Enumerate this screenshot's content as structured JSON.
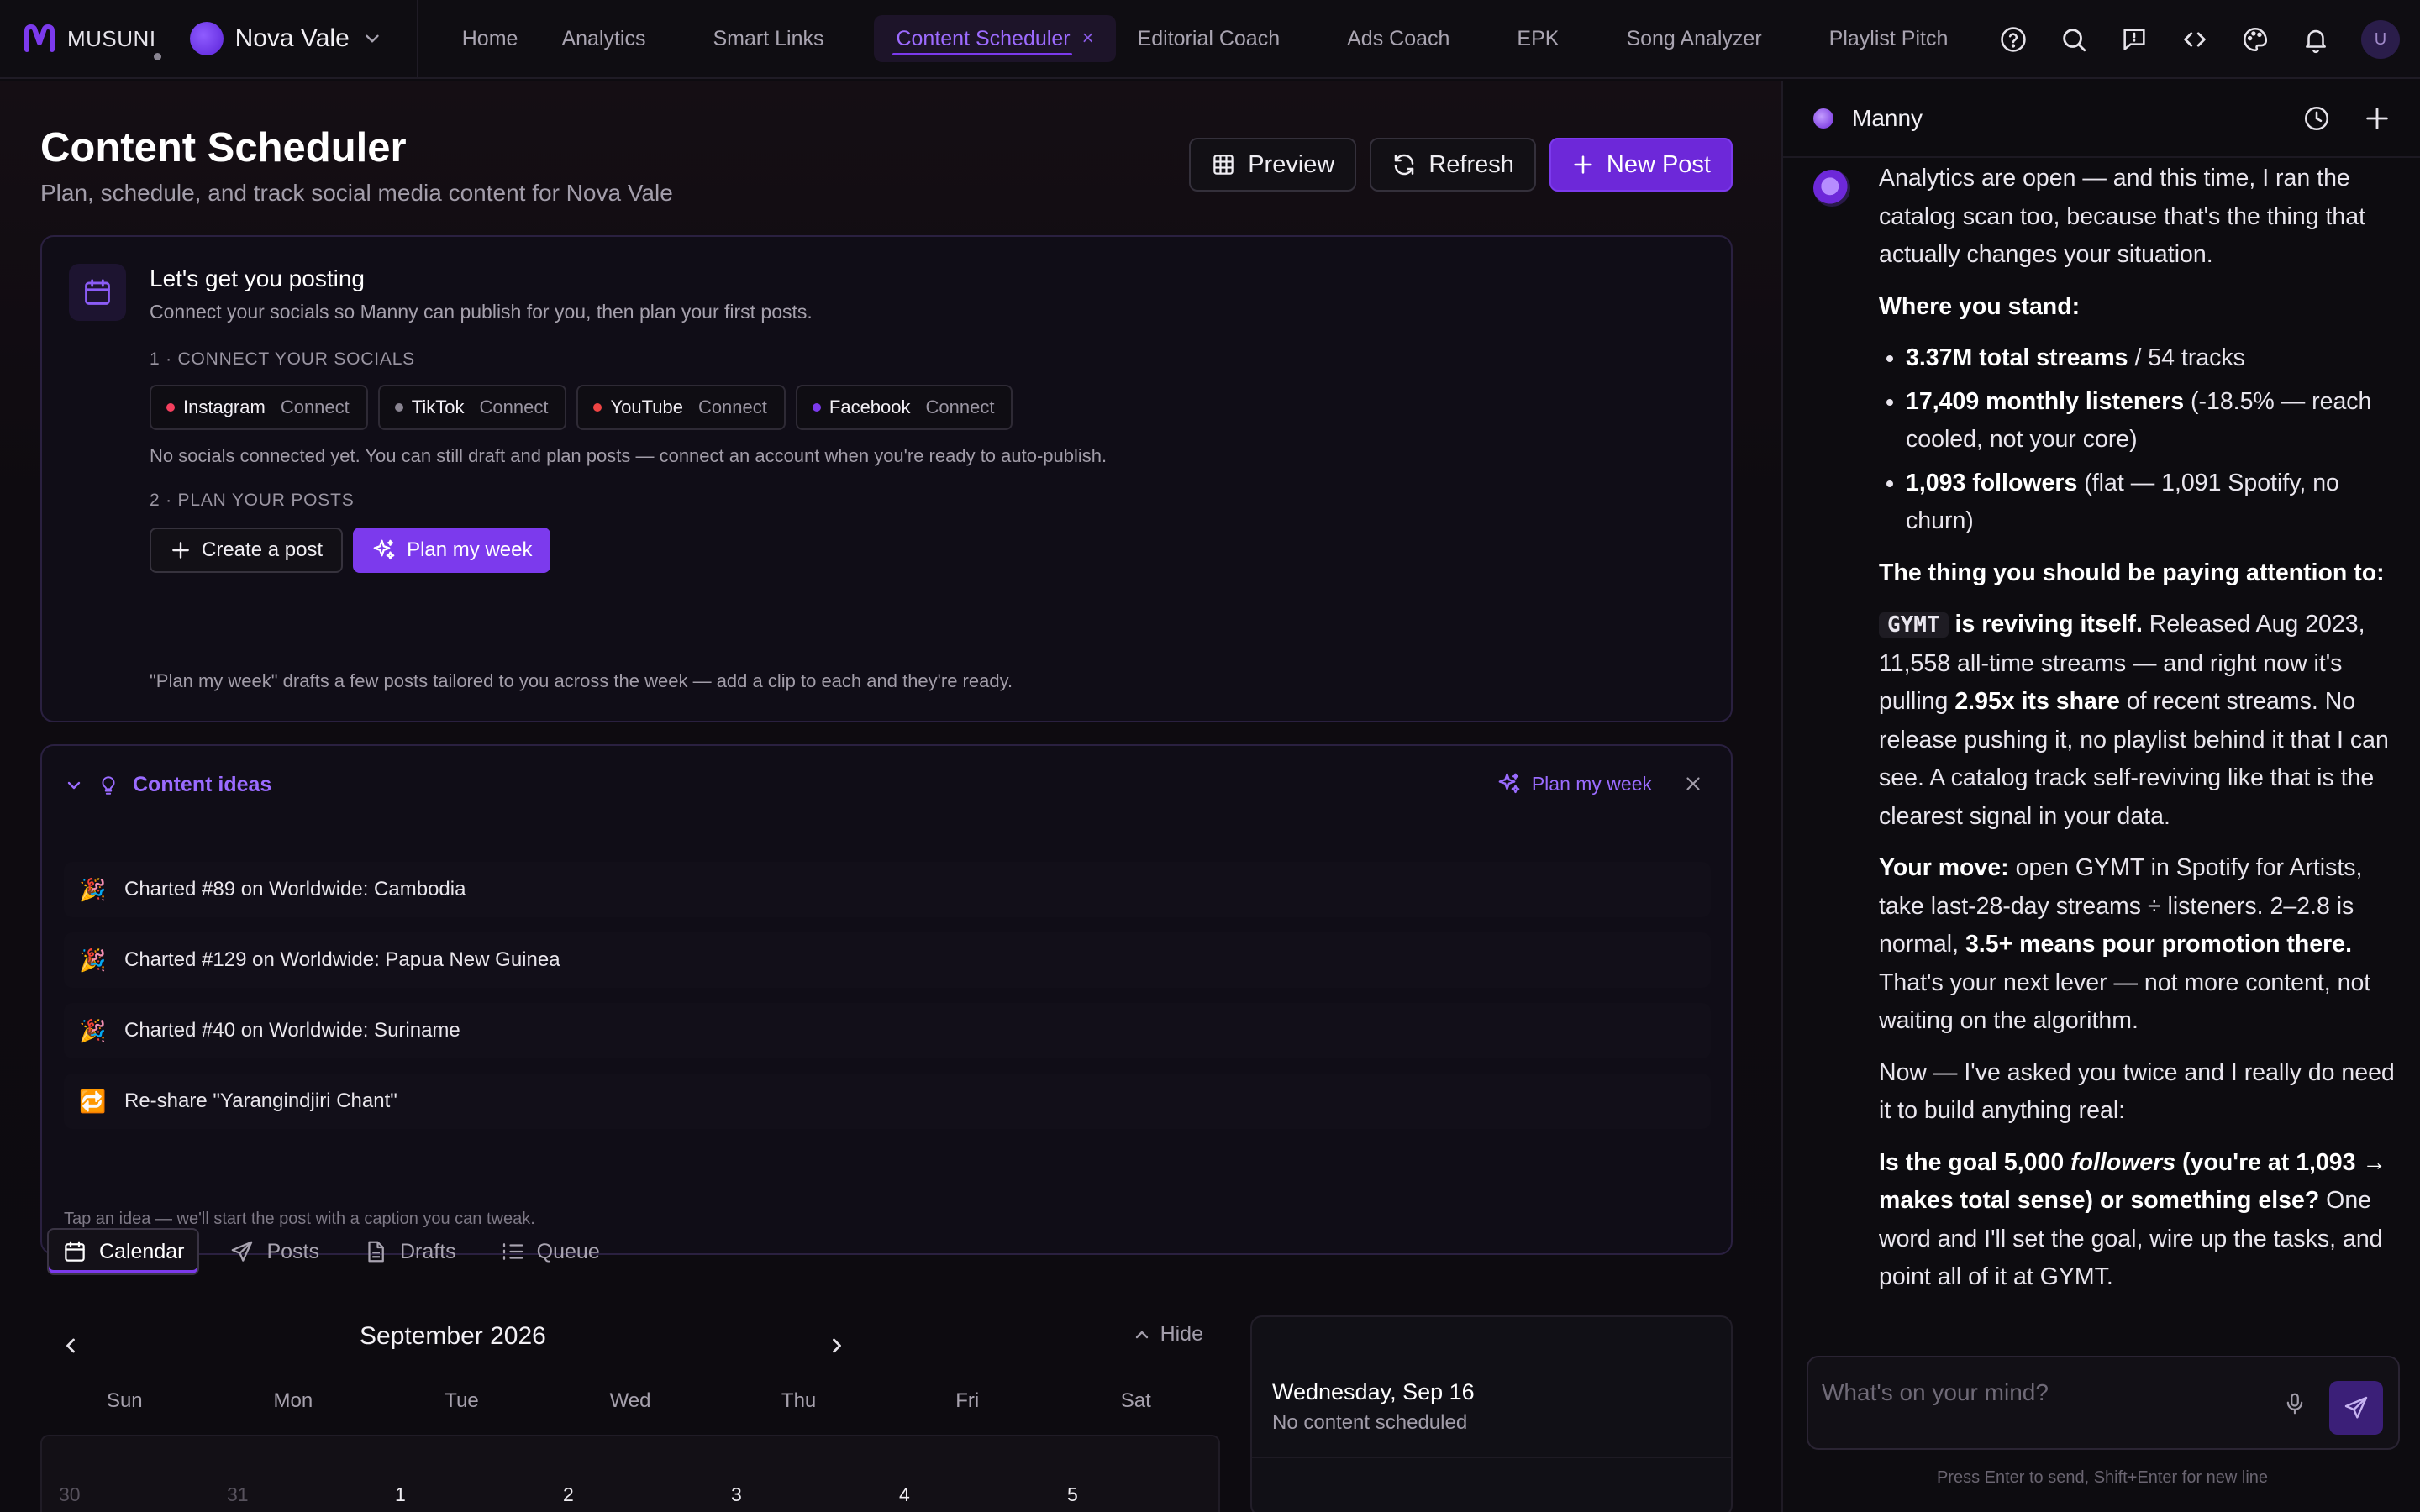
{
  "brand": {
    "name": "MUSUNI"
  },
  "artist": {
    "name": "Nova Vale"
  },
  "nav": {
    "items": [
      "Home",
      "Analytics",
      "Smart Links",
      "Content Scheduler",
      "Editorial Coach",
      "Ads Coach",
      "EPK",
      "Song Analyzer",
      "Playlist Pitch"
    ],
    "active_index": 3,
    "close_glyph": "×"
  },
  "top_icons": [
    "help-icon",
    "search-icon",
    "feedback-icon",
    "code-icon",
    "palette-icon",
    "bell-icon"
  ],
  "user": {
    "initial": "U"
  },
  "page": {
    "title": "Content Scheduler",
    "subtitle": "Plan, schedule, and track social media content for Nova Vale",
    "buttons": {
      "preview": "Preview",
      "refresh": "Refresh",
      "new_post": "New Post"
    }
  },
  "setup": {
    "title": "Let's get you posting",
    "subtitle": "Connect your socials so Manny can publish for you, then plan your first posts.",
    "step1": "1 · CONNECT YOUR SOCIALS",
    "socials": [
      {
        "name": "Instagram",
        "action": "Connect",
        "color": "#f43f5e"
      },
      {
        "name": "TikTok",
        "action": "Connect",
        "color": "#8a8592"
      },
      {
        "name": "YouTube",
        "action": "Connect",
        "color": "#ef4444"
      },
      {
        "name": "Facebook",
        "action": "Connect",
        "color": "#7c3aed"
      }
    ],
    "no_socials_note": "No socials connected yet. You can still draft and plan posts — connect an account when you're ready to auto-publish.",
    "step2": "2 · PLAN YOUR POSTS",
    "create_post": "Create a post",
    "plan_week": "Plan my week",
    "plan_note": "\"Plan my week\" drafts a few posts tailored to you across the week — add a clip to each and they're ready."
  },
  "ideas": {
    "title": "Content ideas",
    "plan_week": "Plan my week",
    "items": [
      {
        "emoji": "🎉",
        "text": "Charted #89 on Worldwide: Cambodia"
      },
      {
        "emoji": "🎉",
        "text": "Charted #129 on Worldwide: Papua New Guinea"
      },
      {
        "emoji": "🎉",
        "text": "Charted #40 on Worldwide: Suriname"
      },
      {
        "emoji": "🔁",
        "text": "Re-share \"Yarangindjiri Chant\""
      }
    ],
    "footer": "Tap an idea — we'll start the post with a caption you can tweak."
  },
  "tabs": [
    "Calendar",
    "Posts",
    "Drafts",
    "Queue"
  ],
  "calendar": {
    "month": "September 2026",
    "hide_label": "Hide",
    "weekdays": [
      "Sun",
      "Mon",
      "Tue",
      "Wed",
      "Thu",
      "Fri",
      "Sat"
    ],
    "first_row": [
      "30",
      "31",
      "1",
      "2",
      "3",
      "4",
      "5"
    ]
  },
  "day_panel": {
    "title": "Wednesday, Sep 16",
    "subtitle": "No content scheduled"
  },
  "chat": {
    "assistant_name": "Manny",
    "m1": "Analytics are open — and this time, I ran the catalog scan too, because that's the thing that actually changes your situation.",
    "m2": "Where you stand:",
    "b1_bold": "3.37M total streams",
    "b1_rest": " / 54 tracks",
    "b2_bold": "17,409 monthly listeners",
    "b2_rest": " (-18.5% — reach cooled, not your core)",
    "b3_bold": "1,093 followers",
    "b3_rest": " (flat — 1,091 Spotify, no churn)",
    "m3": "The thing you should be paying attention to:",
    "p4_code": "GYMT",
    "p4_bold": " is reviving itself.",
    "p4_rest1": " Released Aug 2023, 11,558 all-time streams — and right now it's pulling ",
    "p4_bold2": "2.95x its share",
    "p4_rest2": " of recent streams. No release pushing it, no playlist behind it that I can see. A catalog track self-reviving like that is the clearest signal in your data.",
    "p5_bold": "Your move:",
    "p5_rest1": " open GYMT in Spotify for Artists, take last-28-day streams ÷ listeners. 2–2.8 is normal, ",
    "p5_bold2": "3.5+ means pour promotion there.",
    "p5_rest2": " That's your next lever — not more content, not waiting on the algorithm.",
    "p6": "Now — I've asked you twice and I really do need it to build anything real:",
    "p7_bold1": "Is the goal 5,000 ",
    "p7_italic": "followers",
    "p7_bold2": " (you're at 1,093 → makes total sense) or something else?",
    "p7_rest": " One word and I'll set the goal, wire up the tasks, and point all of it at GYMT.",
    "placeholder": "What's on your mind?",
    "hint": "Press Enter to send, Shift+Enter for new line"
  },
  "colors": {
    "accent": "#7c3aed",
    "accent_text": "#9a6bff",
    "background": "#0d0b10"
  }
}
